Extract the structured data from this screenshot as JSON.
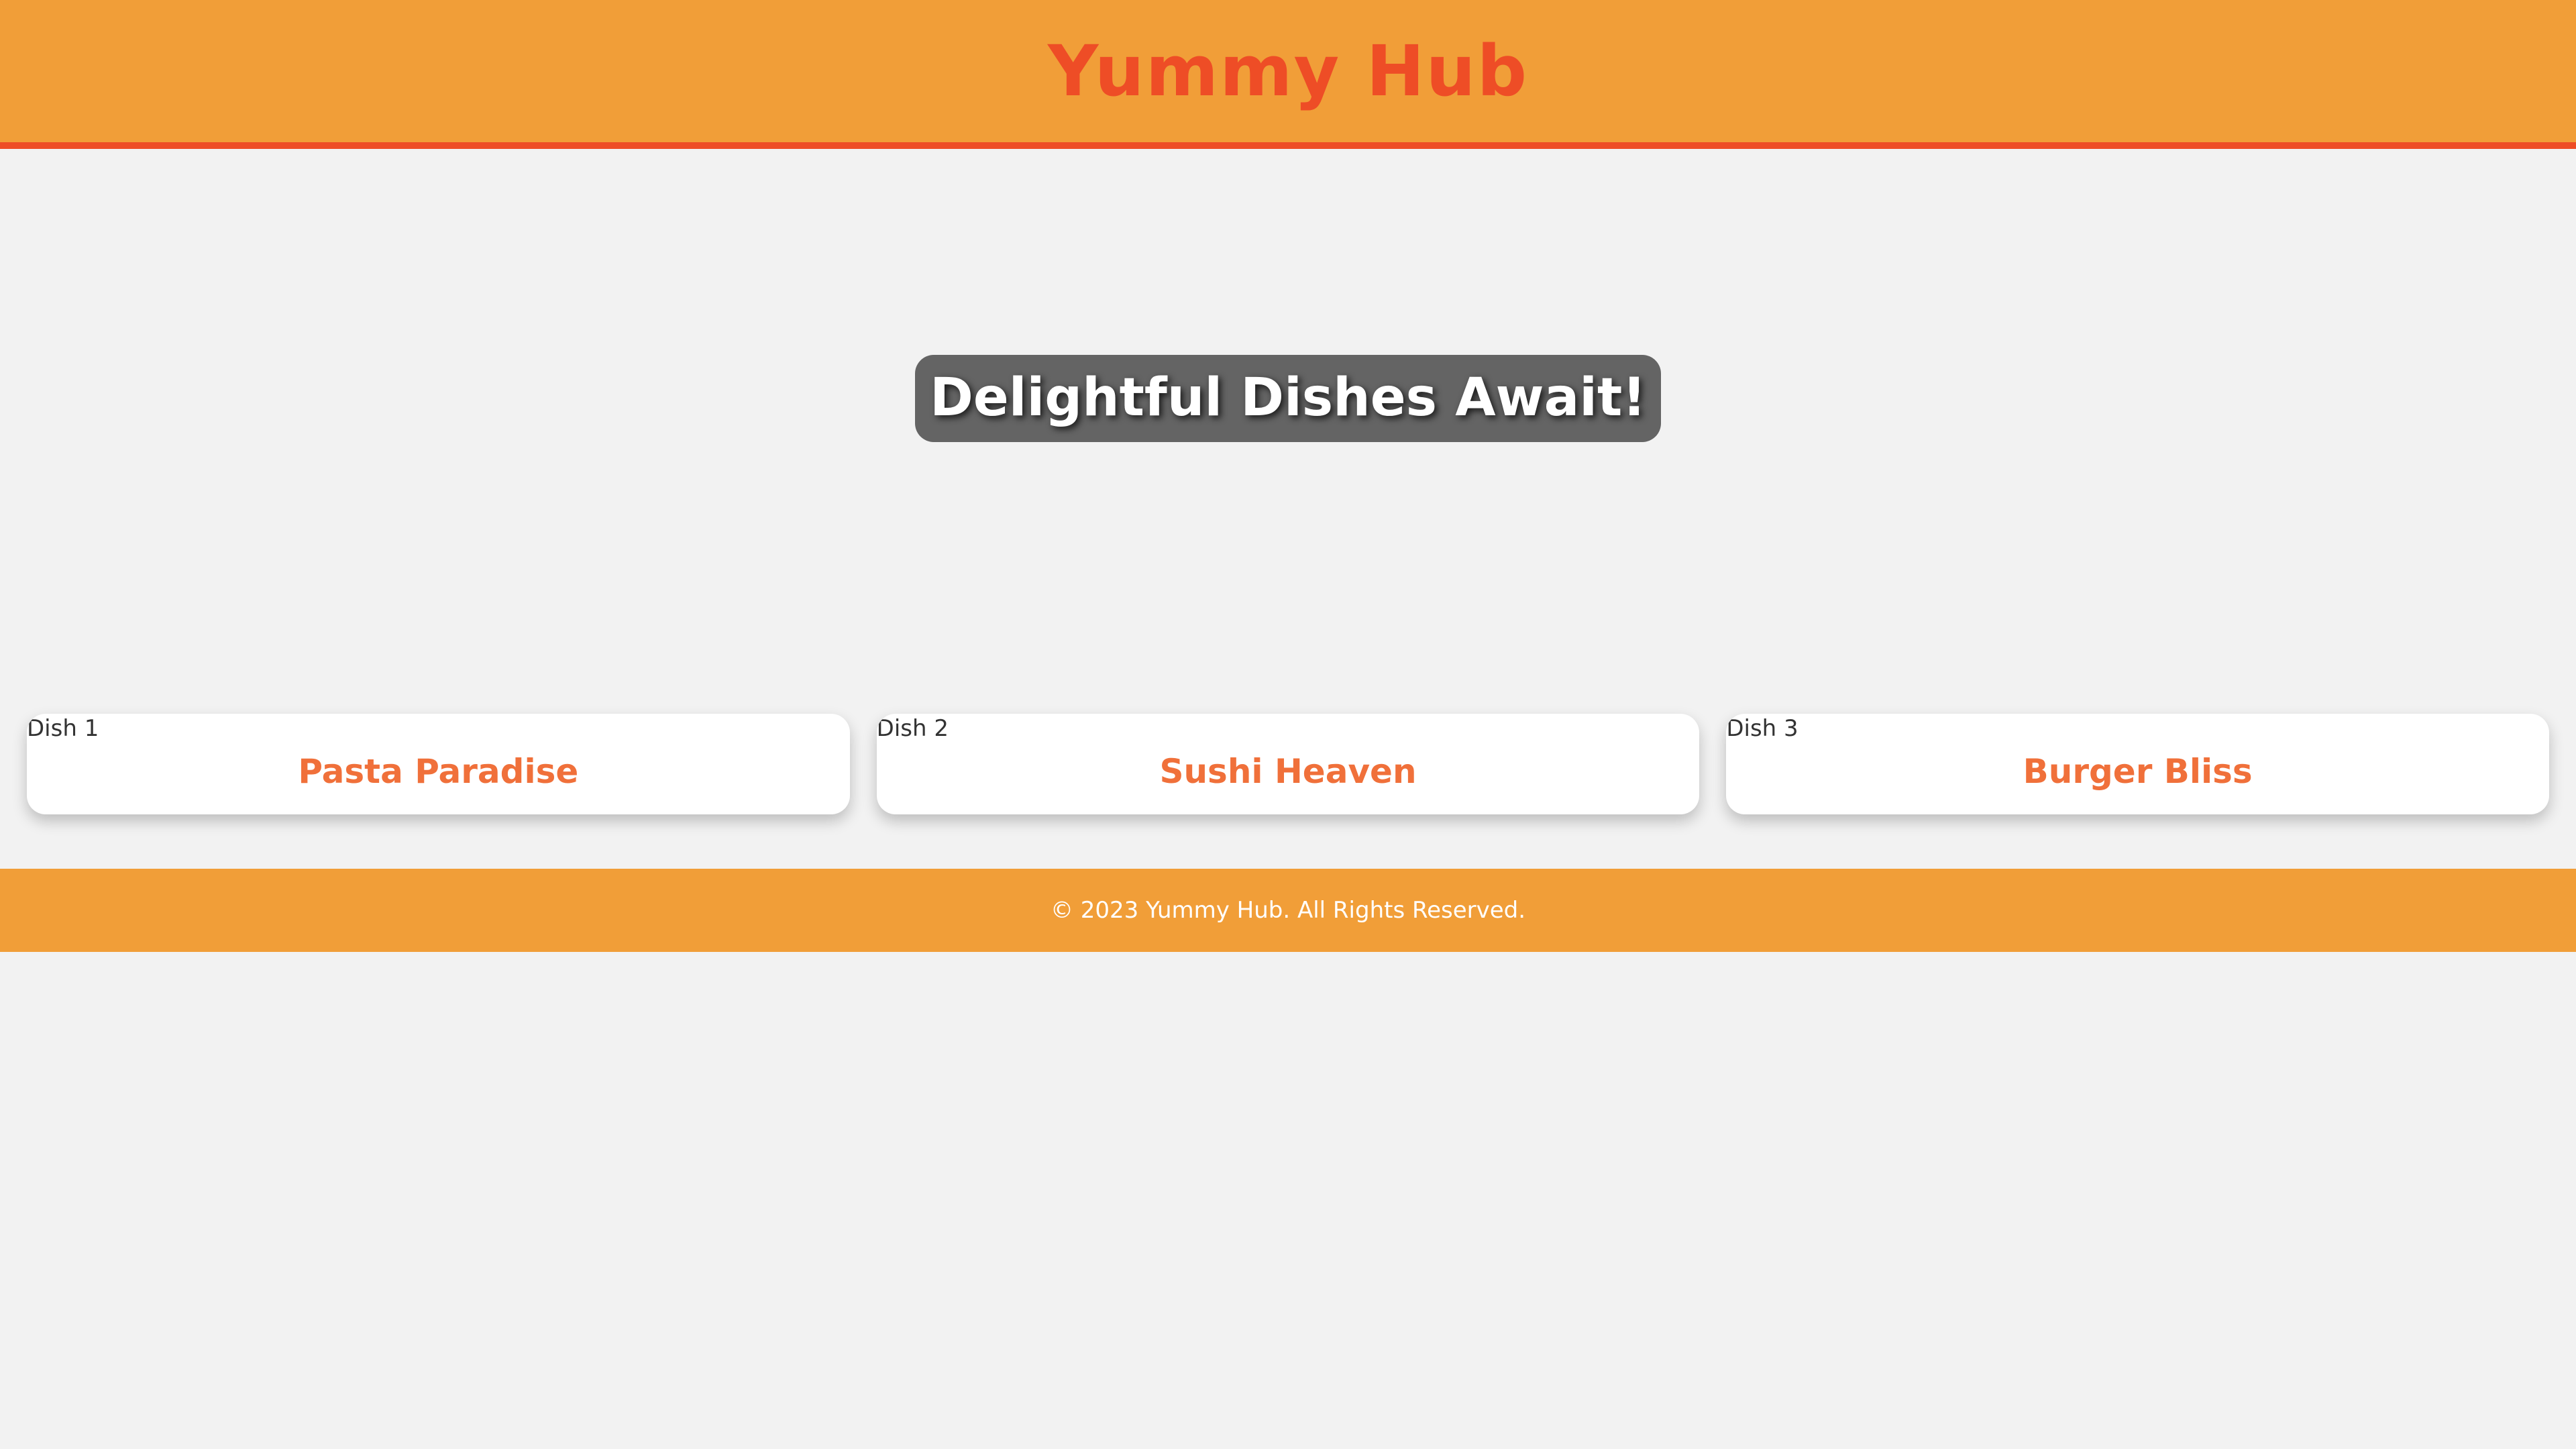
{
  "header": {
    "title": "Yummy Hub"
  },
  "hero": {
    "title": "Delightful Dishes Await!"
  },
  "cards": [
    {
      "image_alt": "Dish 1",
      "title": "Pasta Paradise"
    },
    {
      "image_alt": "Dish 2",
      "title": "Sushi Heaven"
    },
    {
      "image_alt": "Dish 3",
      "title": "Burger Bliss"
    }
  ],
  "footer": {
    "text": "© 2023 Yummy Hub. All Rights Reserved."
  },
  "colors": {
    "header_background": "#f19e38",
    "accent": "#ee4d26",
    "card_title": "#f0703a",
    "page_background": "#f2f2f2",
    "hero_box": "#505050"
  },
  "icons": {
    "card_image": "broken-image-icon"
  }
}
